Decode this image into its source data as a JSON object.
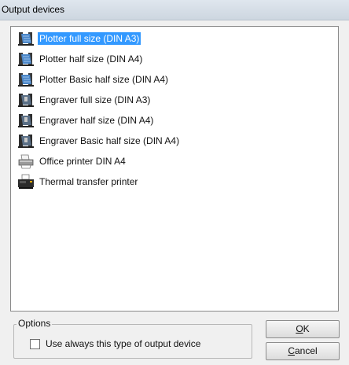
{
  "window": {
    "title": "Output devices"
  },
  "devices": [
    {
      "label": "Plotter full size (DIN A3)",
      "icon": "plotter-icon",
      "selected": true
    },
    {
      "label": "Plotter half size (DIN A4)",
      "icon": "plotter-icon",
      "selected": false
    },
    {
      "label": "Plotter Basic half size (DIN A4)",
      "icon": "plotter-icon",
      "selected": false
    },
    {
      "label": "Engraver full size (DIN A3)",
      "icon": "engraver-icon",
      "selected": false
    },
    {
      "label": "Engraver half size (DIN A4)",
      "icon": "engraver-icon",
      "selected": false
    },
    {
      "label": "Engraver Basic half size (DIN A4)",
      "icon": "engraver-icon",
      "selected": false
    },
    {
      "label": "Office printer DIN A4",
      "icon": "printer-icon",
      "selected": false
    },
    {
      "label": "Thermal transfer printer",
      "icon": "thermal-printer-icon",
      "selected": false
    }
  ],
  "options": {
    "legend": "Options",
    "checkbox_label": "Use always this type of output device",
    "checked": false
  },
  "buttons": {
    "ok_mnemonic": "O",
    "ok_rest": "K",
    "cancel_mnemonic": "C",
    "cancel_rest": "ancel"
  },
  "colors": {
    "selection": "#3399ff",
    "dialog_bg": "#f0f0f0"
  }
}
